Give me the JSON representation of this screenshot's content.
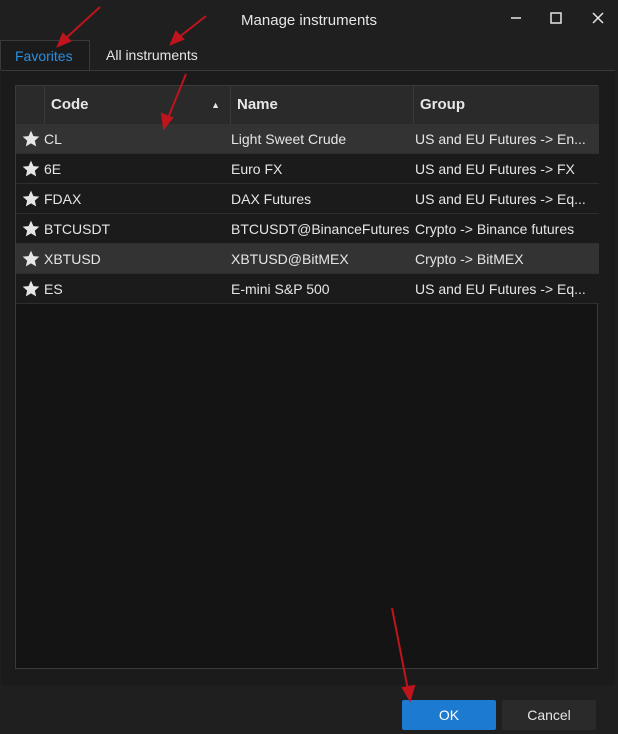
{
  "window": {
    "title": "Manage instruments"
  },
  "tabs": [
    {
      "label": "Favorites",
      "active": true
    },
    {
      "label": "All instruments",
      "active": false
    }
  ],
  "table": {
    "columns": [
      "Code",
      "Name",
      "Group"
    ],
    "sort_column": "Code",
    "rows": [
      {
        "code": "CL",
        "name": "Light Sweet Crude",
        "group": "US and EU Futures -> En...",
        "selected": true
      },
      {
        "code": "6E",
        "name": "Euro FX",
        "group": "US and EU Futures -> FX",
        "selected": false
      },
      {
        "code": "FDAX",
        "name": "DAX Futures",
        "group": "US and EU Futures -> Eq...",
        "selected": false
      },
      {
        "code": "BTCUSDT",
        "name": "BTCUSDT@BinanceFutures",
        "group": "Crypto -> Binance futures",
        "selected": false
      },
      {
        "code": "XBTUSD",
        "name": "XBTUSD@BitMEX",
        "group": "Crypto -> BitMEX",
        "selected": true
      },
      {
        "code": "ES",
        "name": "E-mini S&P 500",
        "group": "US and EU Futures -> Eq...",
        "selected": false
      }
    ]
  },
  "buttons": {
    "ok": "OK",
    "cancel": "Cancel"
  },
  "colors": {
    "accent": "#1d7ad1",
    "tab_active": "#2b8fe0",
    "annotation": "#c0141c"
  },
  "icons": {
    "favorite": "star-icon",
    "sort": "sort-ascending-icon",
    "minimize": "minimize-icon",
    "maximize": "maximize-icon",
    "close": "close-icon"
  }
}
